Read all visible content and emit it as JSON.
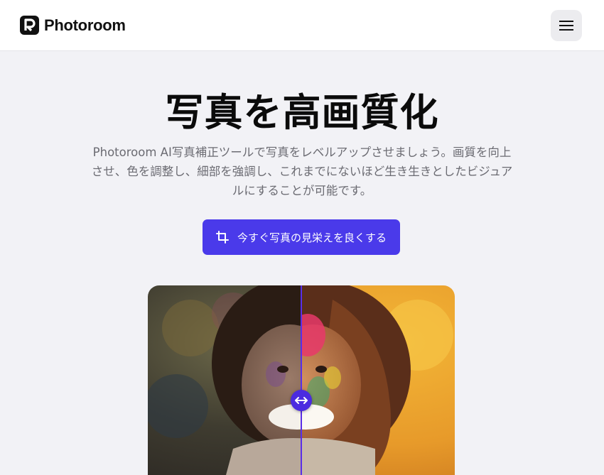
{
  "header": {
    "brand": "Photoroom",
    "logo_icon": "photoroom-logo-icon",
    "menu_icon": "hamburger-menu-icon"
  },
  "hero": {
    "title": "写真を高画質化",
    "description_lines": [
      "Photoroom AI写真補正ツールで写真をレベルアップさせましょう。画質を向上",
      "させ、色を調整し、細部を強調し、これまでにないほど生き生きとしたビジュア",
      "ルにすることが可能です。"
    ]
  },
  "cta": {
    "label": "今すぐ写真の見栄えを良くする",
    "icon": "crop-icon",
    "color": "#4a3aea"
  },
  "compare": {
    "handle_icon": "left-right-arrows-icon",
    "accent": "#4b2be0"
  }
}
